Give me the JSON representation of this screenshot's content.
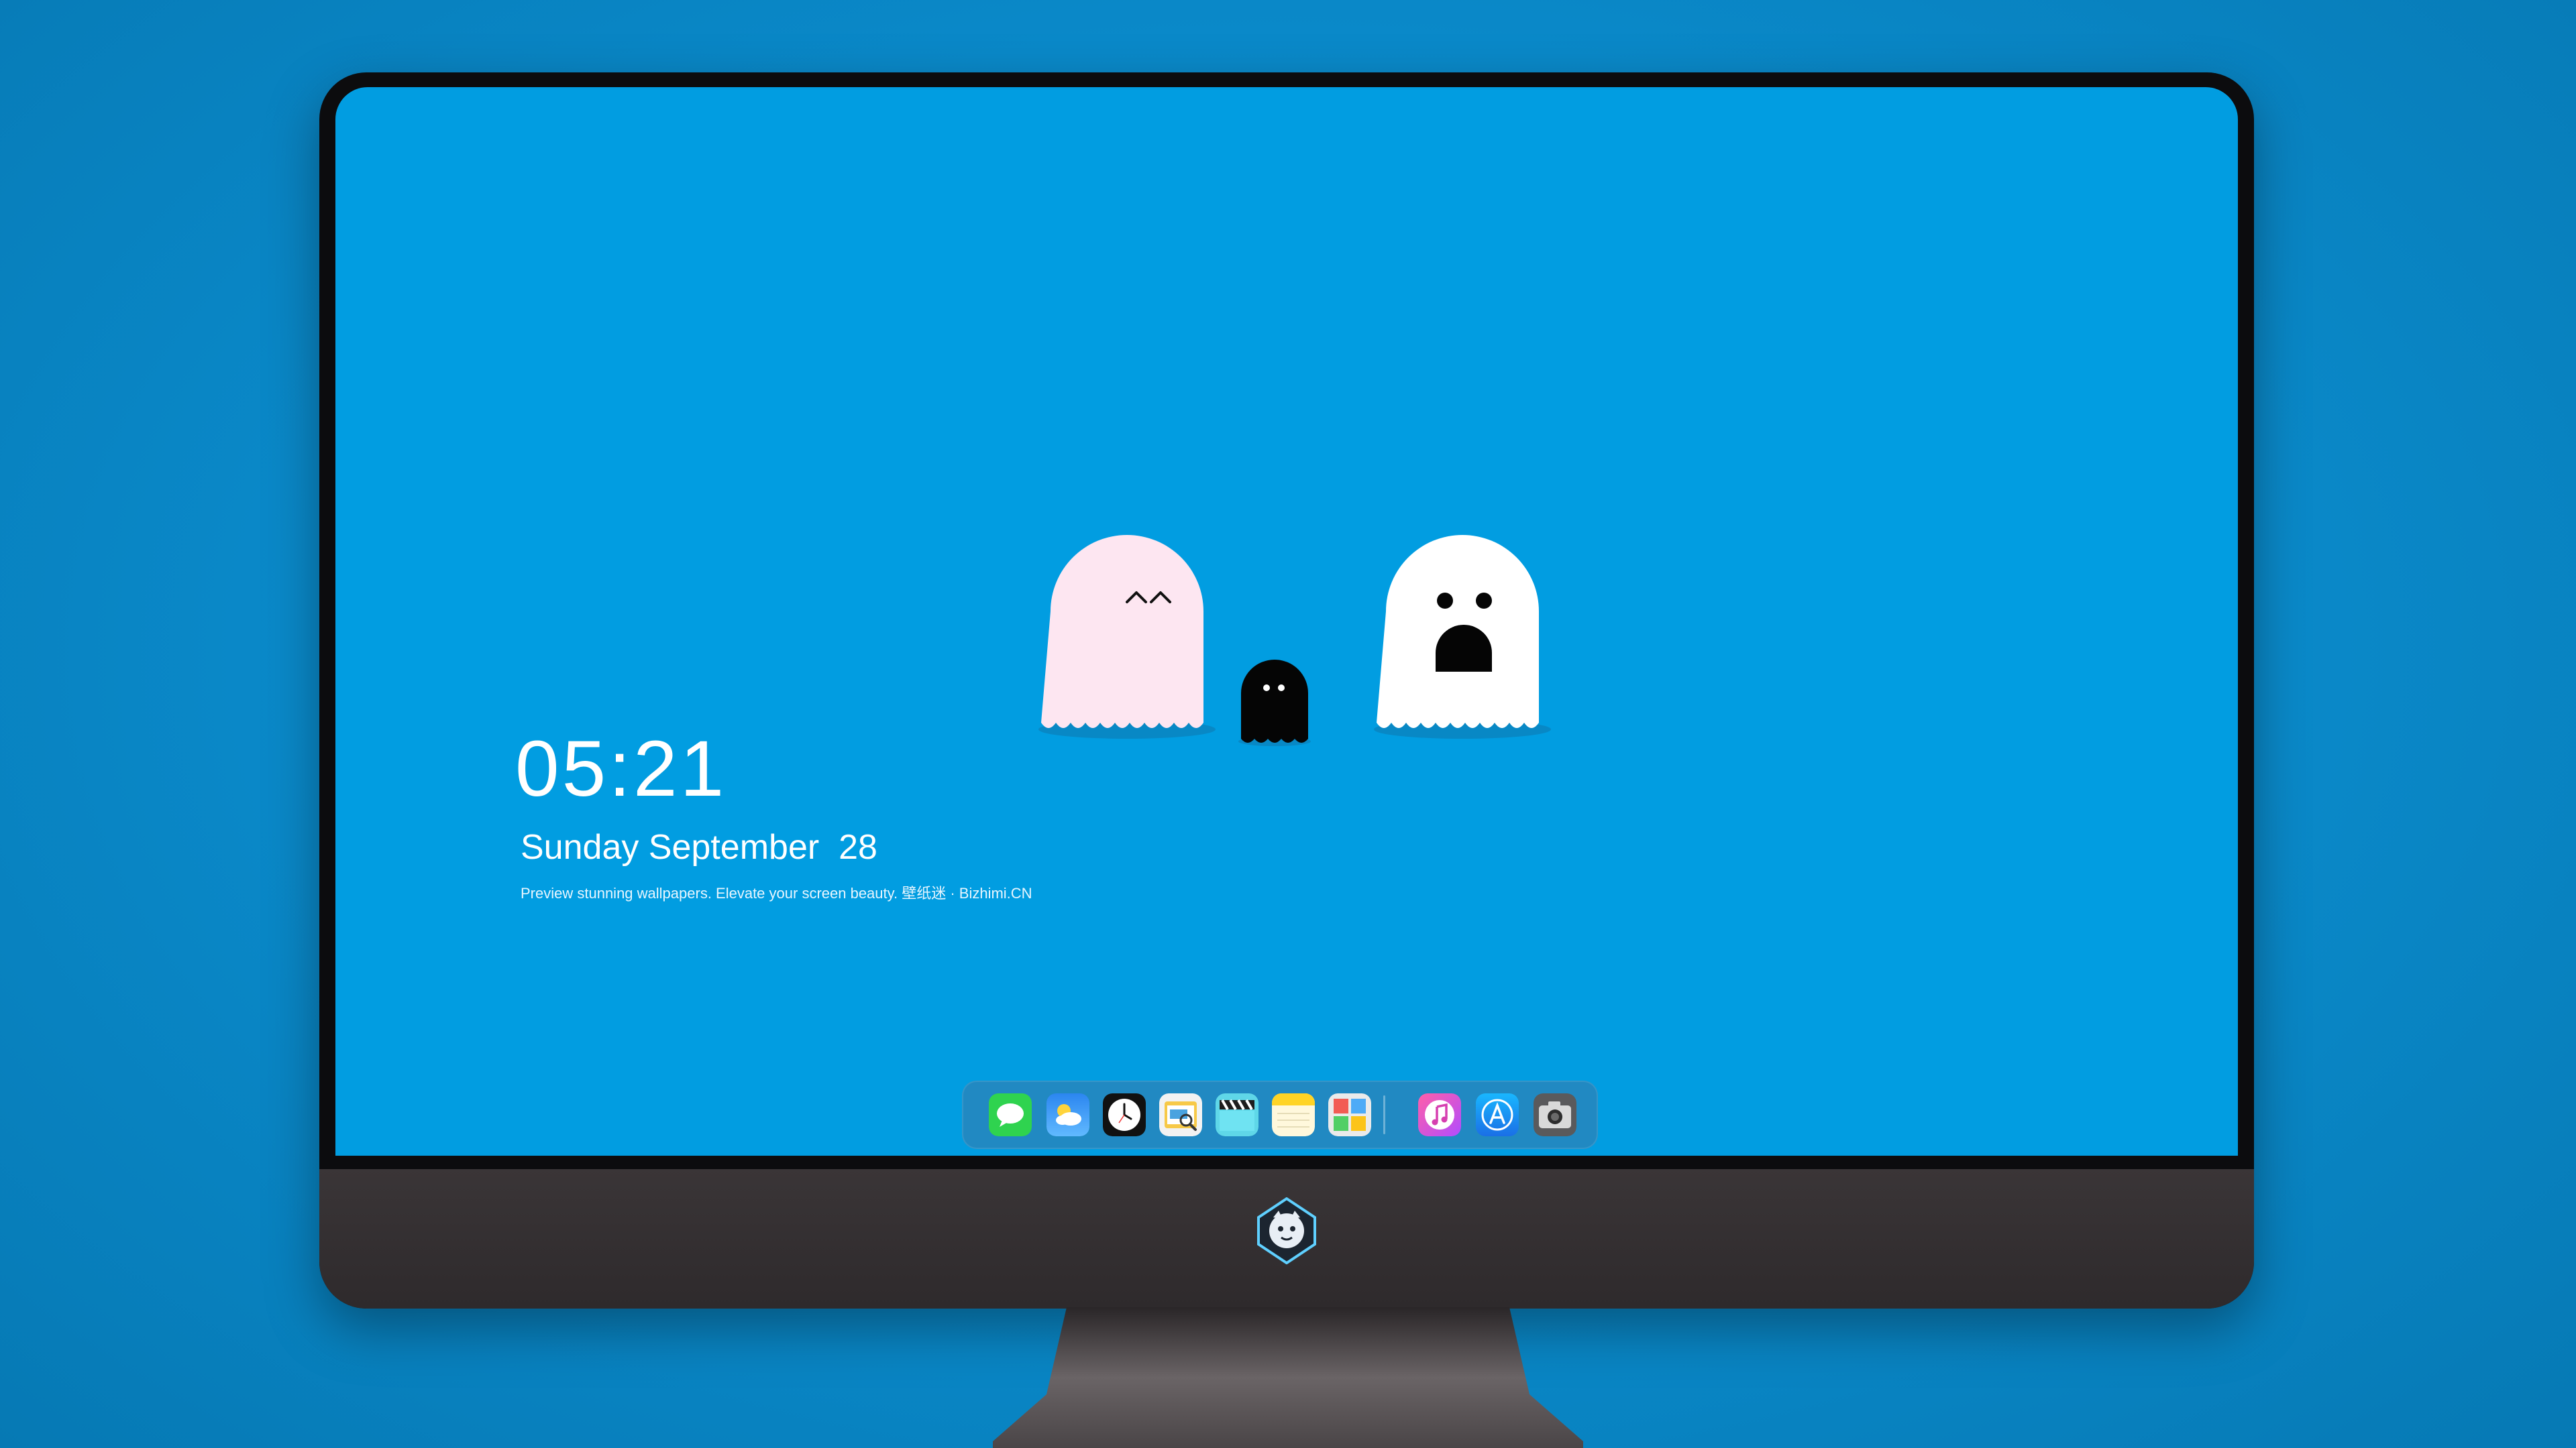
{
  "lockscreen": {
    "time": "05:21",
    "date": "Sunday September  28",
    "tagline": "Preview stunning wallpapers. Elevate your screen beauty. 壁纸迷 · Bizhimi.CN"
  },
  "colors": {
    "background": "#0a8acb",
    "screen": "#019de1",
    "ghost_pink": "#fde6f1",
    "ghost_white": "#ffffff",
    "ghost_black": "#050505"
  },
  "dock": {
    "icons": [
      {
        "name": "messages-icon"
      },
      {
        "name": "weather-icon"
      },
      {
        "name": "clock-icon"
      },
      {
        "name": "preview-icon"
      },
      {
        "name": "clapperboard-icon"
      },
      {
        "name": "notes-icon"
      },
      {
        "name": "photo-browser-icon"
      },
      {
        "name": "music-icon"
      },
      {
        "name": "app-store-icon"
      },
      {
        "name": "camera-icon"
      }
    ]
  }
}
